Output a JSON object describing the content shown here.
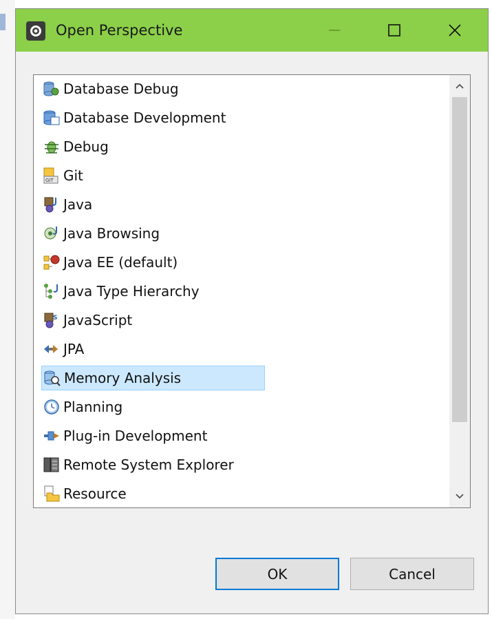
{
  "window": {
    "title": "Open Perspective",
    "controls": {
      "minimize_icon": "minimize-icon",
      "maximize_icon": "maximize-icon",
      "close_icon": "close-icon"
    },
    "titlebar_color": "#8bd048"
  },
  "perspectives": {
    "items": [
      {
        "label": "Database Debug",
        "icon": "database-debug-icon"
      },
      {
        "label": "Database Development",
        "icon": "database-development-icon"
      },
      {
        "label": "Debug",
        "icon": "debug-bug-icon"
      },
      {
        "label": "Git",
        "icon": "git-icon"
      },
      {
        "label": "Java",
        "icon": "java-icon"
      },
      {
        "label": "Java Browsing",
        "icon": "java-browsing-icon"
      },
      {
        "label": "Java EE (default)",
        "icon": "java-ee-icon"
      },
      {
        "label": "Java Type Hierarchy",
        "icon": "java-type-hierarchy-icon"
      },
      {
        "label": "JavaScript",
        "icon": "javascript-icon"
      },
      {
        "label": "JPA",
        "icon": "jpa-icon"
      },
      {
        "label": "Memory Analysis",
        "icon": "memory-analysis-icon",
        "selected": true
      },
      {
        "label": "Planning",
        "icon": "planning-clock-icon"
      },
      {
        "label": "Plug-in Development",
        "icon": "plugin-development-icon"
      },
      {
        "label": "Remote System Explorer",
        "icon": "remote-system-explorer-icon"
      },
      {
        "label": "Resource",
        "icon": "resource-folder-icon"
      }
    ],
    "selected_index": 10
  },
  "buttons": {
    "ok_label": "OK",
    "cancel_label": "Cancel"
  },
  "colors": {
    "selection_bg": "#cce8ff",
    "selection_border": "#99d1ff",
    "default_button_border": "#0078d7"
  }
}
